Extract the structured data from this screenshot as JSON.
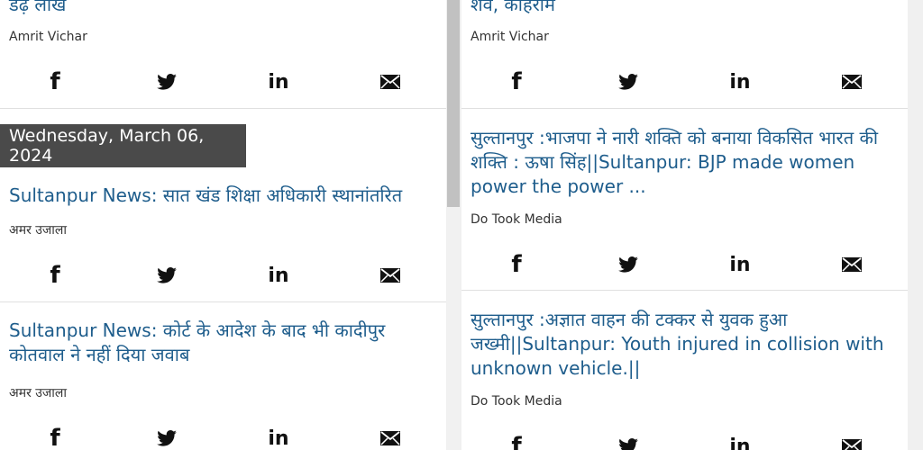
{
  "left": {
    "top_card": {
      "headline": "डेढ़ लाख",
      "source": "Amrit Vichar"
    },
    "date_header": "Wednesday, March 06, 2024",
    "cards": [
      {
        "headline": "Sultanpur News: सात खंड शिक्षा अधिकारी स्थानांतरित",
        "source": "अमर उजाला"
      },
      {
        "headline": "Sultanpur News: कोर्ट के आदेश के बाद भी कादीपुर कोतवाल ने नहीं दिया जवाब",
        "source": "अमर उजाला"
      }
    ]
  },
  "right": {
    "top_card": {
      "headline": "शव, कोहराम",
      "source": "Amrit Vichar"
    },
    "cards": [
      {
        "headline": "सुल्तानपुर :भाजपा ने नारी शक्ति को बनाया विकसित भारत की शक्ति : ऊषा सिंह||Sultanpur: BJP made women power the power ...",
        "source": "Do Took Media"
      },
      {
        "headline": "सुल्तानपुर :अज्ञात वाहन की टक्कर से युवक हुआ जख्मी||Sultanpur: Youth injured in collision with unknown vehicle.||",
        "source": "Do Took Media"
      }
    ]
  },
  "share_icons": [
    "facebook-icon",
    "twitter-icon",
    "linkedin-icon",
    "email-icon"
  ],
  "colors": {
    "headline": "#1e5d8c",
    "date_badge_bg": "#4a4a4a"
  }
}
